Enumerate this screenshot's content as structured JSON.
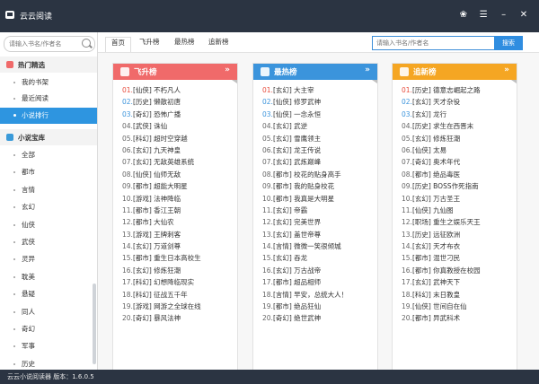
{
  "app": {
    "title": "云云阅读",
    "version_text": "云云小说阅读器 版本：1.6.0.5"
  },
  "sidebar": {
    "search_placeholder": "请输入书名/作者名",
    "section1": {
      "title": "热门精选",
      "items": [
        "我的书架",
        "最近阅读",
        "小说排行"
      ]
    },
    "section2": {
      "title": "小说宝库",
      "items": [
        "全部",
        "都市",
        "言情",
        "玄幻",
        "仙侠",
        "武侠",
        "灵异",
        "耽美",
        "悬疑",
        "同人",
        "奇幻",
        "军事",
        "历史"
      ]
    },
    "active_item": "小说排行"
  },
  "tabs": [
    "首页",
    "飞升榜",
    "最热榜",
    "追新榜"
  ],
  "top_search": {
    "placeholder": "请输入书名/作者名",
    "button": "搜索"
  },
  "panels": [
    {
      "title": "飞升榜",
      "color": "#f06a6a",
      "items": [
        {
          "num": "01.",
          "text": "[仙侠] 不朽凡人"
        },
        {
          "num": "02.",
          "text": "[历史] 懒散初唐"
        },
        {
          "num": "03.",
          "text": "[奇幻] 恐怖广播"
        },
        {
          "num": "04.",
          "text": "[武侠] 诛仙"
        },
        {
          "num": "05.",
          "text": "[科幻] 超时空穿越"
        },
        {
          "num": "06.",
          "text": "[玄幻] 九天神皇"
        },
        {
          "num": "07.",
          "text": "[玄幻] 无敌英雄系统"
        },
        {
          "num": "08.",
          "text": "[仙侠] 仙师无敌"
        },
        {
          "num": "09.",
          "text": "[都市] 超能大明星"
        },
        {
          "num": "10.",
          "text": "[游戏] 法神降临"
        },
        {
          "num": "11.",
          "text": "[都市] 香江王朝"
        },
        {
          "num": "12.",
          "text": "[都市] 大仙农"
        },
        {
          "num": "13.",
          "text": "[游戏] 王牌刺客"
        },
        {
          "num": "14.",
          "text": "[玄幻] 万道剑尊"
        },
        {
          "num": "15.",
          "text": "[都市] 重生日本高校生"
        },
        {
          "num": "16.",
          "text": "[玄幻] 修炼狂潮"
        },
        {
          "num": "17.",
          "text": "[科幻] 幻想降临现实"
        },
        {
          "num": "18.",
          "text": "[科幻] 征战五千年"
        },
        {
          "num": "19.",
          "text": "[游戏] 网游之全球在线"
        },
        {
          "num": "20.",
          "text": "[奇幻] 暴风法神"
        }
      ]
    },
    {
      "title": "最热榜",
      "color": "#3b94dc",
      "items": [
        {
          "num": "01.",
          "text": "[玄幻] 大主宰"
        },
        {
          "num": "02.",
          "text": "[仙侠] 修罗武神"
        },
        {
          "num": "03.",
          "text": "[仙侠] 一念永恒"
        },
        {
          "num": "04.",
          "text": "[玄幻] 武逆"
        },
        {
          "num": "05.",
          "text": "[玄幻] 雪鹰领主"
        },
        {
          "num": "06.",
          "text": "[玄幻] 龙王传说"
        },
        {
          "num": "07.",
          "text": "[玄幻] 武炼巅峰"
        },
        {
          "num": "08.",
          "text": "[都市] 校花的贴身高手"
        },
        {
          "num": "09.",
          "text": "[都市] 我的贴身校花"
        },
        {
          "num": "10.",
          "text": "[都市] 我真是大明星"
        },
        {
          "num": "11.",
          "text": "[玄幻] 帝霸"
        },
        {
          "num": "12.",
          "text": "[玄幻] 完美世界"
        },
        {
          "num": "13.",
          "text": "[玄幻] 盖世帝尊"
        },
        {
          "num": "14.",
          "text": "[言情] 微微一笑很倾城"
        },
        {
          "num": "15.",
          "text": "[玄幻] 吞龙"
        },
        {
          "num": "16.",
          "text": "[玄幻] 万古战帝"
        },
        {
          "num": "17.",
          "text": "[都市] 超品相师"
        },
        {
          "num": "18.",
          "text": "[言情] 早安，总统大人！"
        },
        {
          "num": "19.",
          "text": "[都市] 绝品狂仙"
        },
        {
          "num": "20.",
          "text": "[奇幻] 绝世武神"
        }
      ]
    },
    {
      "title": "追新榜",
      "color": "#f5a623",
      "items": [
        {
          "num": "01.",
          "text": "[历史] 德意志崛起之路"
        },
        {
          "num": "02.",
          "text": "[玄幻] 天才杂役"
        },
        {
          "num": "03.",
          "text": "[玄幻] 龙行"
        },
        {
          "num": "04.",
          "text": "[历史] 求生在西晋末"
        },
        {
          "num": "05.",
          "text": "[玄幻] 修炼狂潮"
        },
        {
          "num": "06.",
          "text": "[仙侠] 太易"
        },
        {
          "num": "07.",
          "text": "[奇幻] 奥术年代"
        },
        {
          "num": "08.",
          "text": "[都市] 绝品毒医"
        },
        {
          "num": "09.",
          "text": "[历史] BOSS作死指南"
        },
        {
          "num": "10.",
          "text": "[玄幻] 万古圣王"
        },
        {
          "num": "11.",
          "text": "[仙侠] 九仙图"
        },
        {
          "num": "12.",
          "text": "[职场] 重生之娱乐天王"
        },
        {
          "num": "13.",
          "text": "[历史] 远征欧洲"
        },
        {
          "num": "14.",
          "text": "[玄幻] 天才布衣"
        },
        {
          "num": "15.",
          "text": "[都市] 混世刁民"
        },
        {
          "num": "16.",
          "text": "[都市] 你真教授在校园"
        },
        {
          "num": "17.",
          "text": "[玄幻] 武神天下"
        },
        {
          "num": "18.",
          "text": "[科幻] 末日教皇"
        },
        {
          "num": "19.",
          "text": "[仙侠] 世间自在仙"
        },
        {
          "num": "20.",
          "text": "[都市] 异武科术"
        }
      ]
    }
  ]
}
